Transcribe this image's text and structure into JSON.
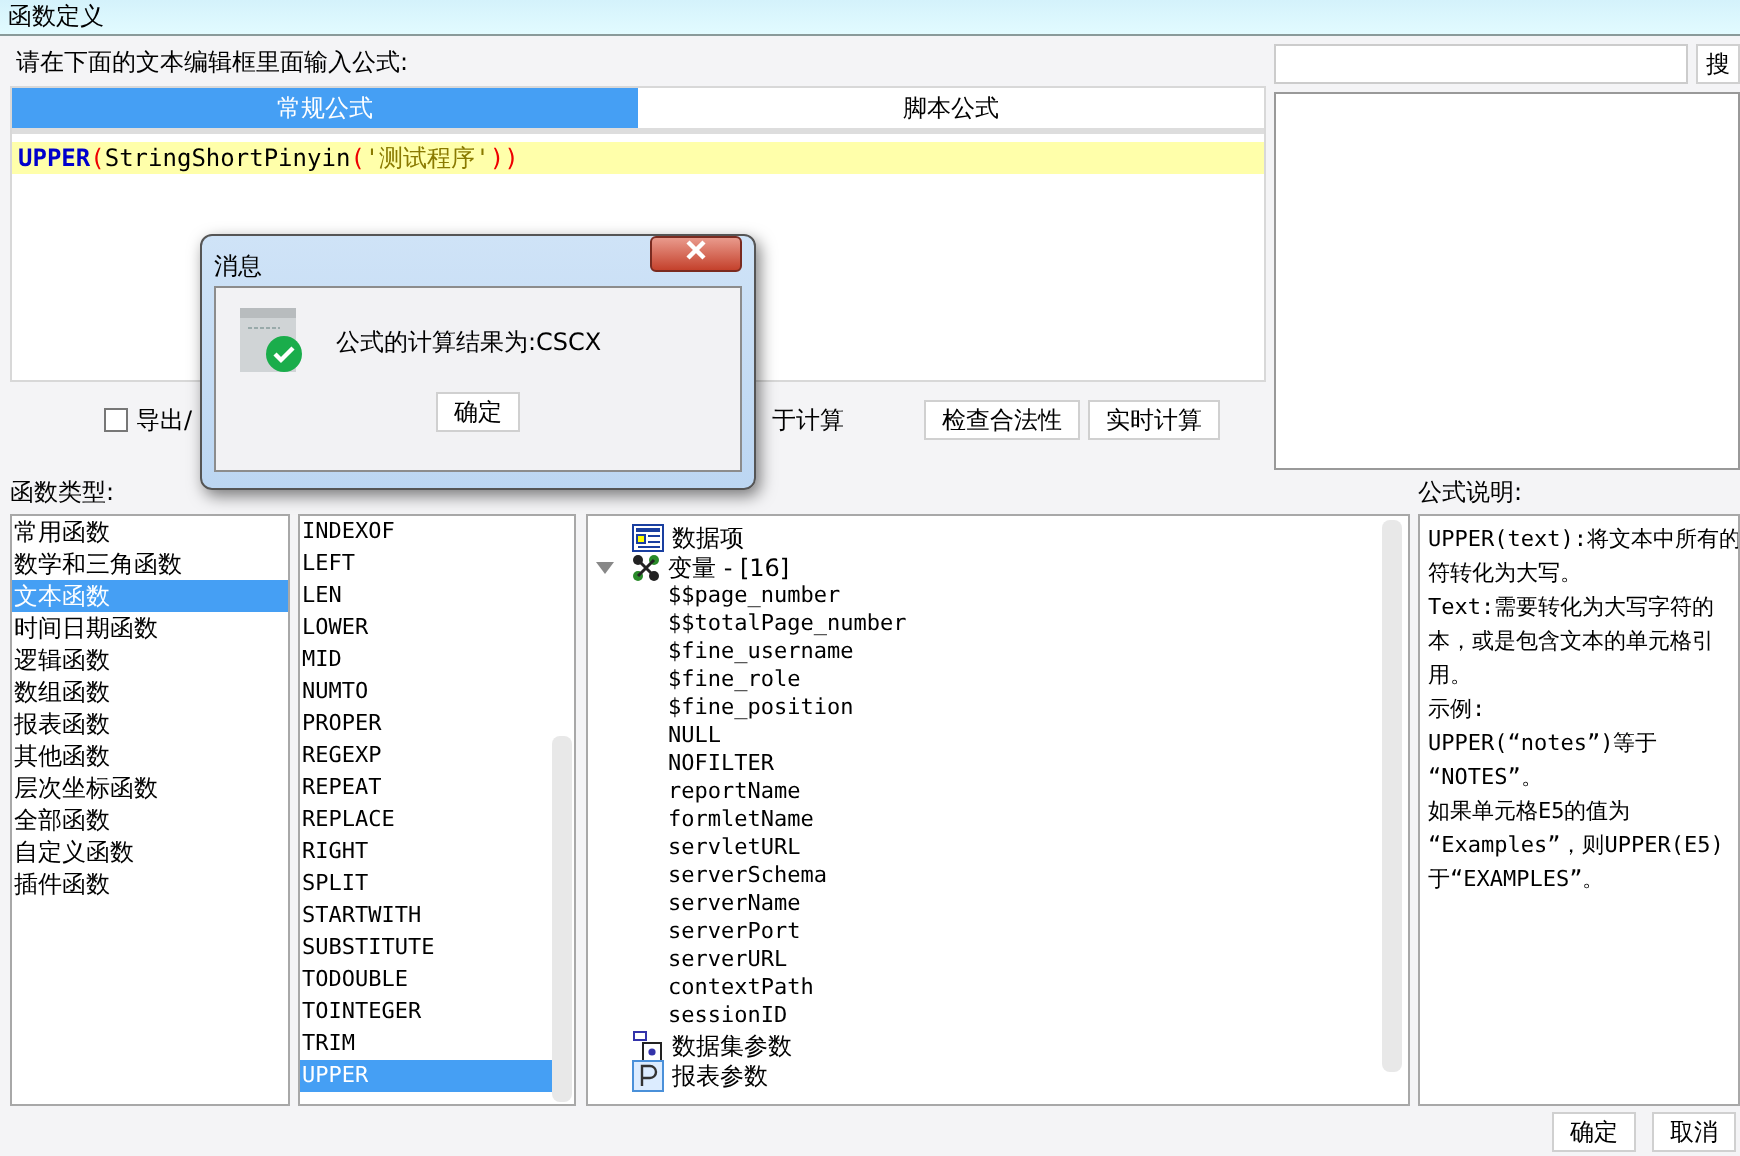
{
  "window": {
    "title": "函数定义"
  },
  "prompt": "请在下面的文本编辑框里面输入公式:",
  "formula_tabs": [
    {
      "label": "常规公式",
      "selected": true
    },
    {
      "label": "脚本公式",
      "selected": false
    }
  ],
  "editor": {
    "tokens": [
      {
        "text": "UPPER",
        "kind": "keyword"
      },
      {
        "text": "(",
        "kind": "paren"
      },
      {
        "text": "StringShortPinyin",
        "kind": "plain"
      },
      {
        "text": "(",
        "kind": "paren"
      },
      {
        "text": "'测试程序'",
        "kind": "string"
      },
      {
        "text": "))",
        "kind": "paren"
      }
    ]
  },
  "search": {
    "button": "搜"
  },
  "options": {
    "checkbox_label": "导出/",
    "checked": false,
    "label_tail": "于计算"
  },
  "actions": [
    "检查合法性",
    "实时计算"
  ],
  "categories": {
    "heading": "函数类型:",
    "items": [
      {
        "label": "常用函数",
        "selected": false
      },
      {
        "label": "数学和三角函数",
        "selected": false
      },
      {
        "label": "文本函数",
        "selected": true
      },
      {
        "label": "时间日期函数",
        "selected": false
      },
      {
        "label": "逻辑函数",
        "selected": false
      },
      {
        "label": "数组函数",
        "selected": false
      },
      {
        "label": "报表函数",
        "selected": false
      },
      {
        "label": "其他函数",
        "selected": false
      },
      {
        "label": "层次坐标函数",
        "selected": false
      },
      {
        "label": "全部函数",
        "selected": false
      },
      {
        "label": "自定义函数",
        "selected": false
      },
      {
        "label": "插件函数",
        "selected": false
      }
    ]
  },
  "functions": [
    {
      "label": "INDEXOF",
      "selected": false
    },
    {
      "label": "LEFT",
      "selected": false
    },
    {
      "label": "LEN",
      "selected": false
    },
    {
      "label": "LOWER",
      "selected": false
    },
    {
      "label": "MID",
      "selected": false
    },
    {
      "label": "NUMTO",
      "selected": false
    },
    {
      "label": "PROPER",
      "selected": false
    },
    {
      "label": "REGEXP",
      "selected": false
    },
    {
      "label": "REPEAT",
      "selected": false
    },
    {
      "label": "REPLACE",
      "selected": false
    },
    {
      "label": "RIGHT",
      "selected": false
    },
    {
      "label": "SPLIT",
      "selected": false
    },
    {
      "label": "STARTWITH",
      "selected": false
    },
    {
      "label": "SUBSTITUTE",
      "selected": false
    },
    {
      "label": "TODOUBLE",
      "selected": false
    },
    {
      "label": "TOINTEGER",
      "selected": false
    },
    {
      "label": "TRIM",
      "selected": false
    },
    {
      "label": "UPPER",
      "selected": true
    }
  ],
  "tree": [
    {
      "label": "数据项",
      "kind": "data"
    },
    {
      "label": "变量 - [16]",
      "kind": "variables",
      "expanded": true,
      "children": [
        {
          "label": "$$page_number"
        },
        {
          "label": "$$totalPage_number"
        },
        {
          "label": "$fine_username"
        },
        {
          "label": "$fine_role"
        },
        {
          "label": "$fine_position"
        },
        {
          "label": "NULL"
        },
        {
          "label": "NOFILTER"
        },
        {
          "label": "reportName"
        },
        {
          "label": "formletName"
        },
        {
          "label": "servletURL"
        },
        {
          "label": "serverSchema"
        },
        {
          "label": "serverName"
        },
        {
          "label": "serverPort"
        },
        {
          "label": "serverURL"
        },
        {
          "label": "contextPath"
        },
        {
          "label": "sessionID"
        }
      ]
    },
    {
      "label": "数据集参数",
      "kind": "dataset"
    },
    {
      "label": "报表参数",
      "kind": "param"
    }
  ],
  "description": {
    "heading": "公式说明:",
    "lines": [
      "UPPER(text):将文本中所有的",
      "符转化为大写。",
      "Text:需要转化为大写字符的",
      "本，或是包含文本的单元格引",
      "用。",
      "示例:",
      "UPPER(“notes”)等于",
      "“NOTES”。",
      "如果单元格E5的值为",
      "“Examples”，则UPPER(E5)",
      "于“EXAMPLES”。"
    ]
  },
  "footer_buttons": [
    "确定",
    "取消"
  ],
  "dialog": {
    "title": "消息",
    "message": "公式的计算结果为:CSCX",
    "button": "确定"
  }
}
